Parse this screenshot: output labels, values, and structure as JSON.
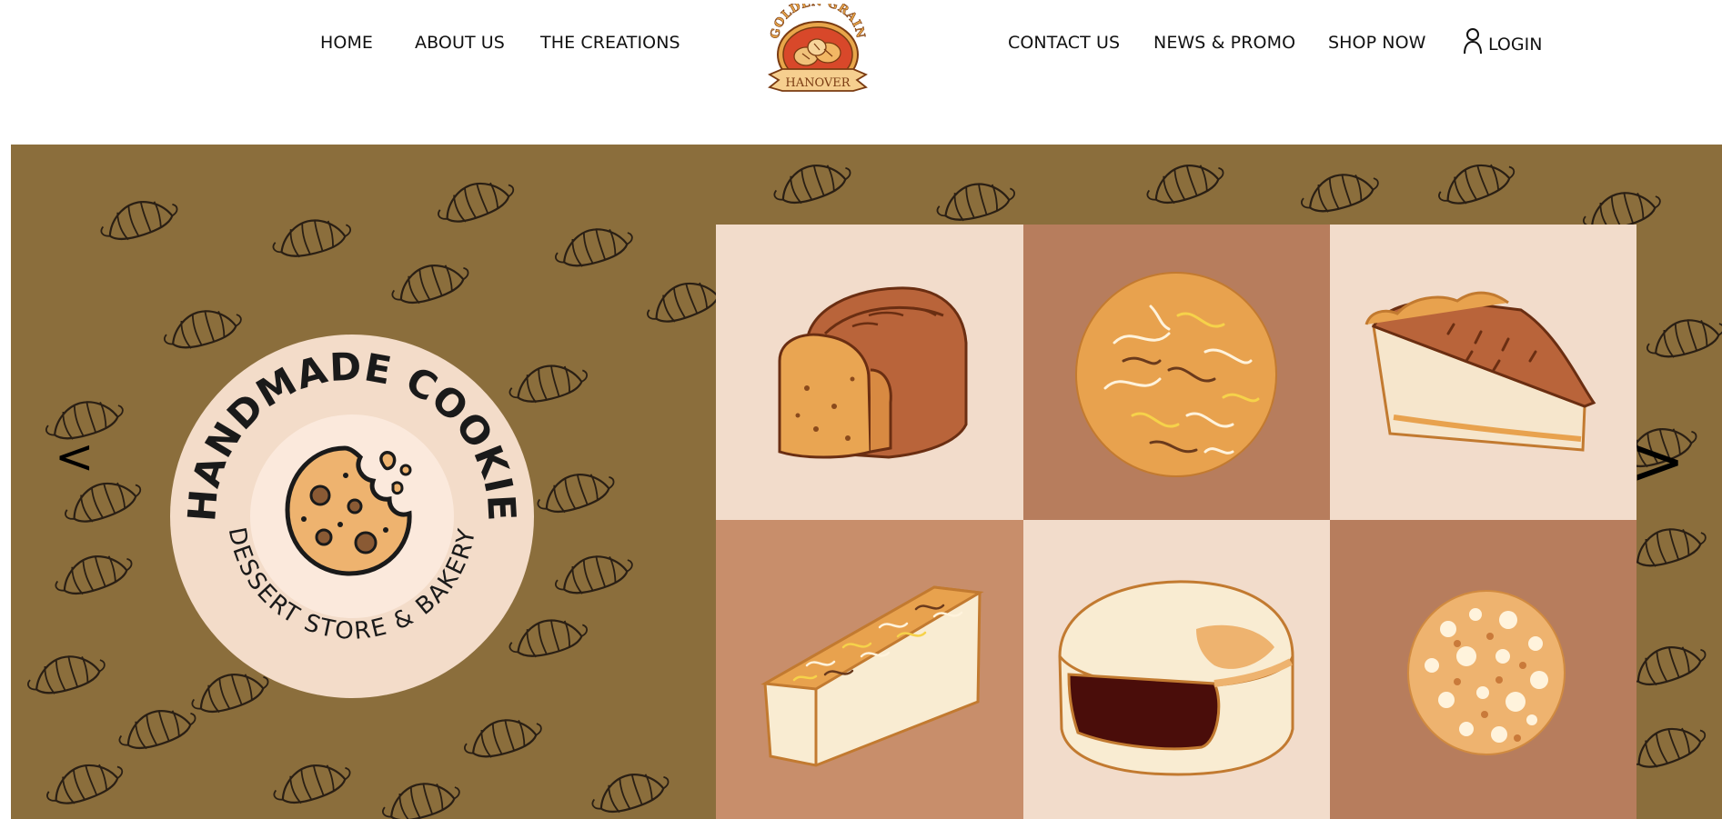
{
  "nav": {
    "left": [
      "HOME",
      "ABOUT US",
      "THE CREATIONS"
    ],
    "right": [
      "CONTACT US",
      "NEWS & PROMO",
      "SHOP NOW"
    ],
    "login_label": "LOGIN"
  },
  "logo": {
    "arc_text": "GOLDEN GRAIN",
    "banner_text": "HANOVER"
  },
  "hero": {
    "badge_top_text": "HANDMADE COOKIE",
    "badge_bottom_text": "DESSERT STORE & BAKERY",
    "prev_label": "<",
    "next_label": ">",
    "gallery": [
      {
        "item": "bread-loaf"
      },
      {
        "item": "coconut-bun"
      },
      {
        "item": "pie-slice"
      },
      {
        "item": "cheese-bar"
      },
      {
        "item": "filled-pastry"
      },
      {
        "item": "sugar-cookie"
      }
    ]
  },
  "colors": {
    "hero_bg": "#8b6e3c",
    "tile_light": "#f2dccb",
    "tile_mid": "#b77d5d",
    "tile_tan": "#c88e6b",
    "badge_bg": "#f3dcc9",
    "logo_red": "#d8482a",
    "logo_gold": "#e8a64a"
  },
  "icons": [
    "user-icon",
    "croissant-pattern",
    "cookie-icon"
  ]
}
